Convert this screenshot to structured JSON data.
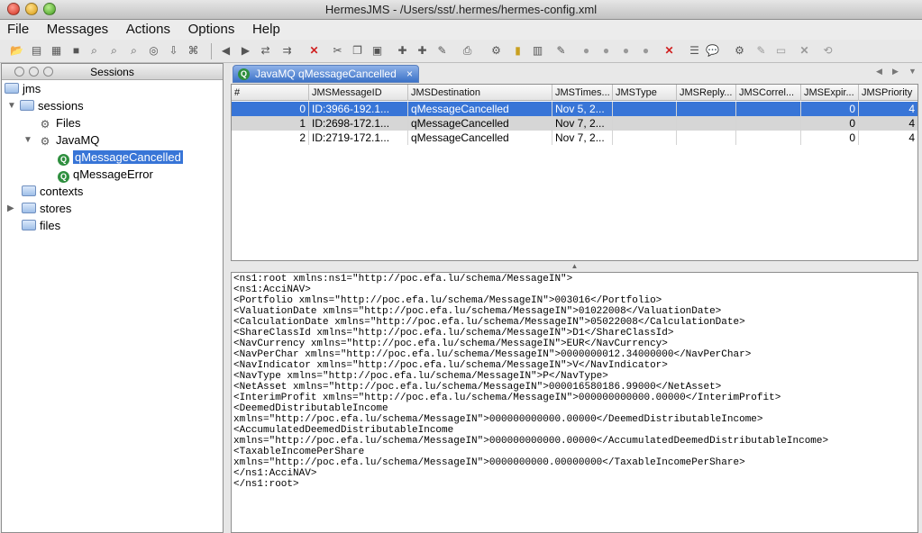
{
  "window": {
    "title": "HermesJMS - /Users/sst/.hermes/hermes-config.xml"
  },
  "menu": [
    "File",
    "Messages",
    "Actions",
    "Options",
    "Help"
  ],
  "sessions_panel": {
    "title": "Sessions",
    "tree": [
      {
        "label": "jms",
        "icon": "folder-icon"
      },
      {
        "label": "sessions",
        "icon": "folder-icon"
      },
      {
        "label": "Files",
        "icon": "session-icon"
      },
      {
        "label": "JavaMQ",
        "icon": "session-icon"
      },
      {
        "label": "qMessageCancelled",
        "icon": "queue-icon"
      },
      {
        "label": "qMessageError",
        "icon": "queue-icon"
      },
      {
        "label": "contexts",
        "icon": "folder-icon"
      },
      {
        "label": "stores",
        "icon": "folder-icon"
      },
      {
        "label": "files",
        "icon": "folder-icon"
      }
    ]
  },
  "tab": {
    "label": "JavaMQ qMessageCancelled",
    "close": "×"
  },
  "table": {
    "columns": [
      "#",
      "JMSMessageID",
      "JMSDestination",
      "JMSTimes...",
      "JMSType",
      "JMSReply...",
      "JMSCorrel...",
      "JMSExpir...",
      "JMSPriority"
    ],
    "rows": [
      [
        "0",
        "ID:3966-192.1...",
        "qMessageCancelled",
        "Nov 5, 2...",
        "",
        "",
        "",
        "0",
        "4"
      ],
      [
        "1",
        "ID:2698-172.1...",
        "qMessageCancelled",
        "Nov 7, 2...",
        "",
        "",
        "",
        "0",
        "4"
      ],
      [
        "2",
        "ID:2719-172.1...",
        "qMessageCancelled",
        "Nov 7, 2...",
        "",
        "",
        "",
        "0",
        "4"
      ]
    ]
  },
  "message_body": [
    "<ns1:root xmlns:ns1=\"http://poc.efa.lu/schema/MessageIN\">",
    "<ns1:AcciNAV>",
    "<Portfolio xmlns=\"http://poc.efa.lu/schema/MessageIN\">003016</Portfolio>",
    "<ValuationDate xmlns=\"http://poc.efa.lu/schema/MessageIN\">01022008</ValuationDate>",
    "<CalculationDate xmlns=\"http://poc.efa.lu/schema/MessageIN\">05022008</CalculationDate>",
    "<ShareClassId xmlns=\"http://poc.efa.lu/schema/MessageIN\">D1</ShareClassId>",
    "<NavCurrency xmlns=\"http://poc.efa.lu/schema/MessageIN\">EUR</NavCurrency>",
    "<NavPerChar xmlns=\"http://poc.efa.lu/schema/MessageIN\">0000000012.34000000</NavPerChar>",
    "<NavIndicator xmlns=\"http://poc.efa.lu/schema/MessageIN\">V</NavIndicator>",
    "<NavType xmlns=\"http://poc.efa.lu/schema/MessageIN\">P</NavType>",
    "<NetAsset xmlns=\"http://poc.efa.lu/schema/MessageIN\">000016580186.99000</NetAsset>",
    "<InterimProfit xmlns=\"http://poc.efa.lu/schema/MessageIN\">000000000000.00000</InterimProfit>",
    "<DeemedDistributableIncome",
    "xmlns=\"http://poc.efa.lu/schema/MessageIN\">000000000000.00000</DeemedDistributableIncome>",
    "<AccumulatedDeemedDistributableIncome",
    "xmlns=\"http://poc.efa.lu/schema/MessageIN\">000000000000.00000</AccumulatedDeemedDistributableIncome>",
    "<TaxableIncomePerShare",
    "xmlns=\"http://poc.efa.lu/schema/MessageIN\">0000000000.00000000</TaxableIncomePerShare>",
    "</ns1:AcciNAV>",
    "</ns1:root>"
  ]
}
